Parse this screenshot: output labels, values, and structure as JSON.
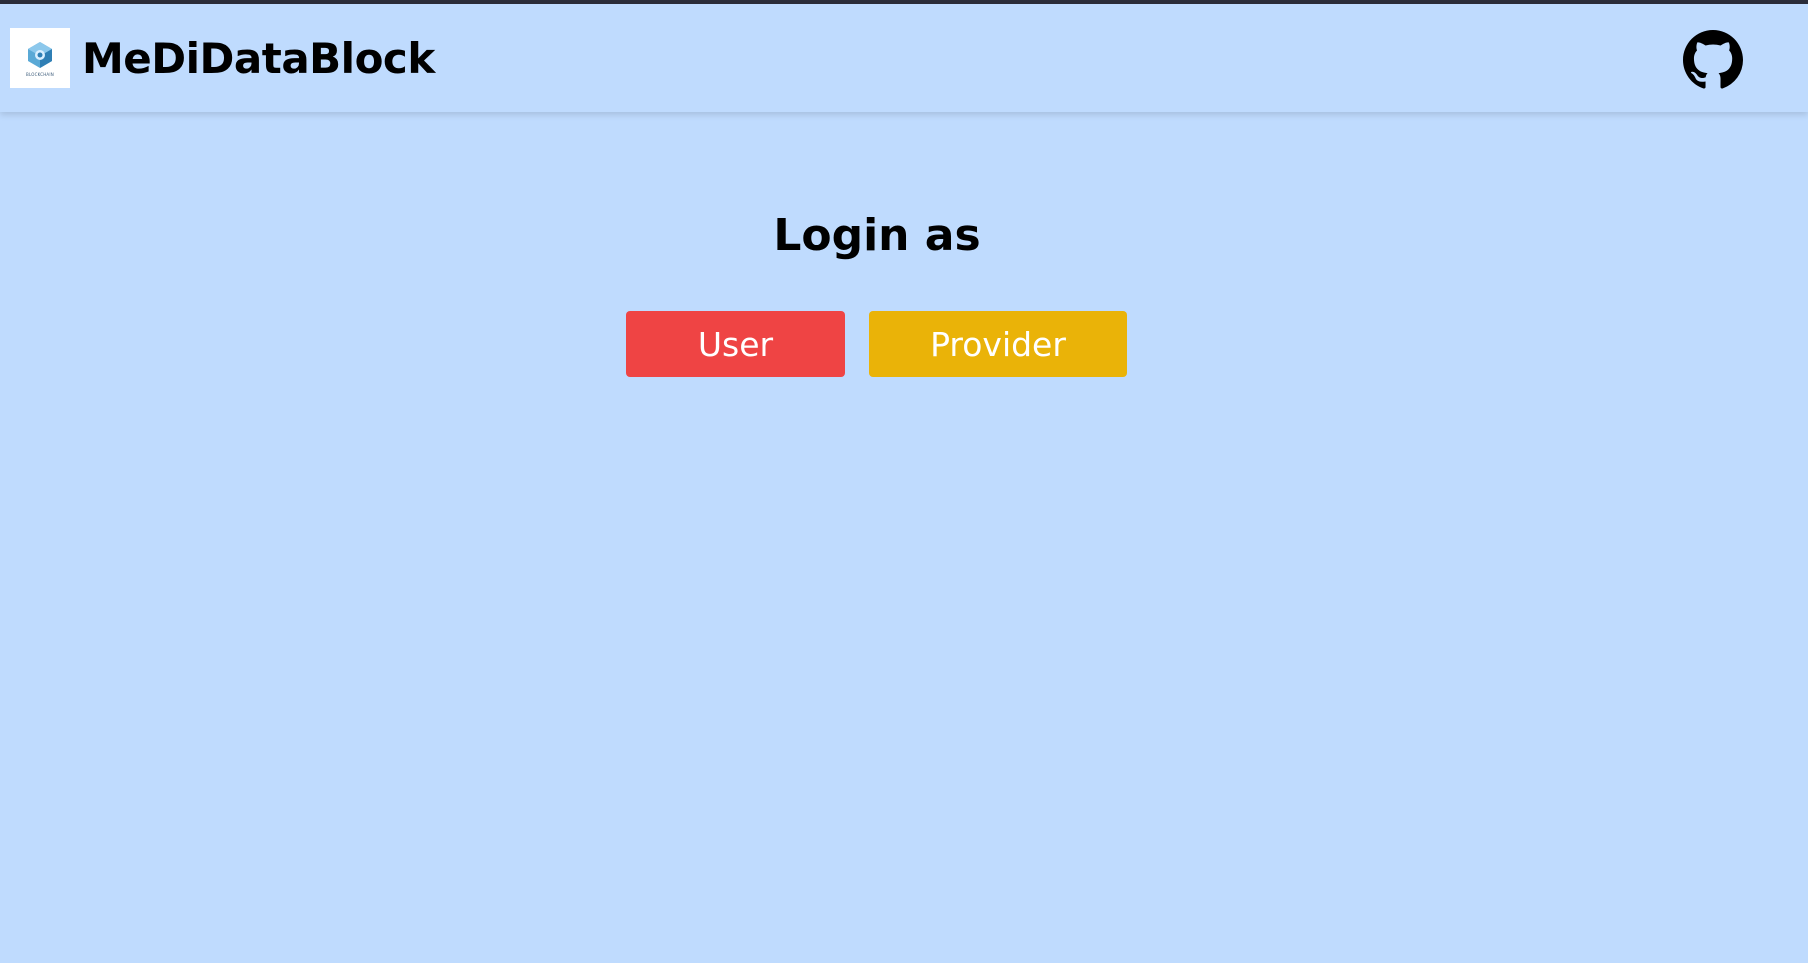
{
  "brand": {
    "name": "MeDiDataBlock",
    "logo_caption": "BLOCKCHAIN",
    "logo_icon": "blockchain-cube-icon"
  },
  "header": {
    "github_icon": "github-icon"
  },
  "main": {
    "title": "Login as",
    "buttons": {
      "user_label": "User",
      "provider_label": "Provider"
    }
  },
  "colors": {
    "background": "#bfdbfe",
    "user_button": "#ef4444",
    "provider_button": "#eab308"
  }
}
